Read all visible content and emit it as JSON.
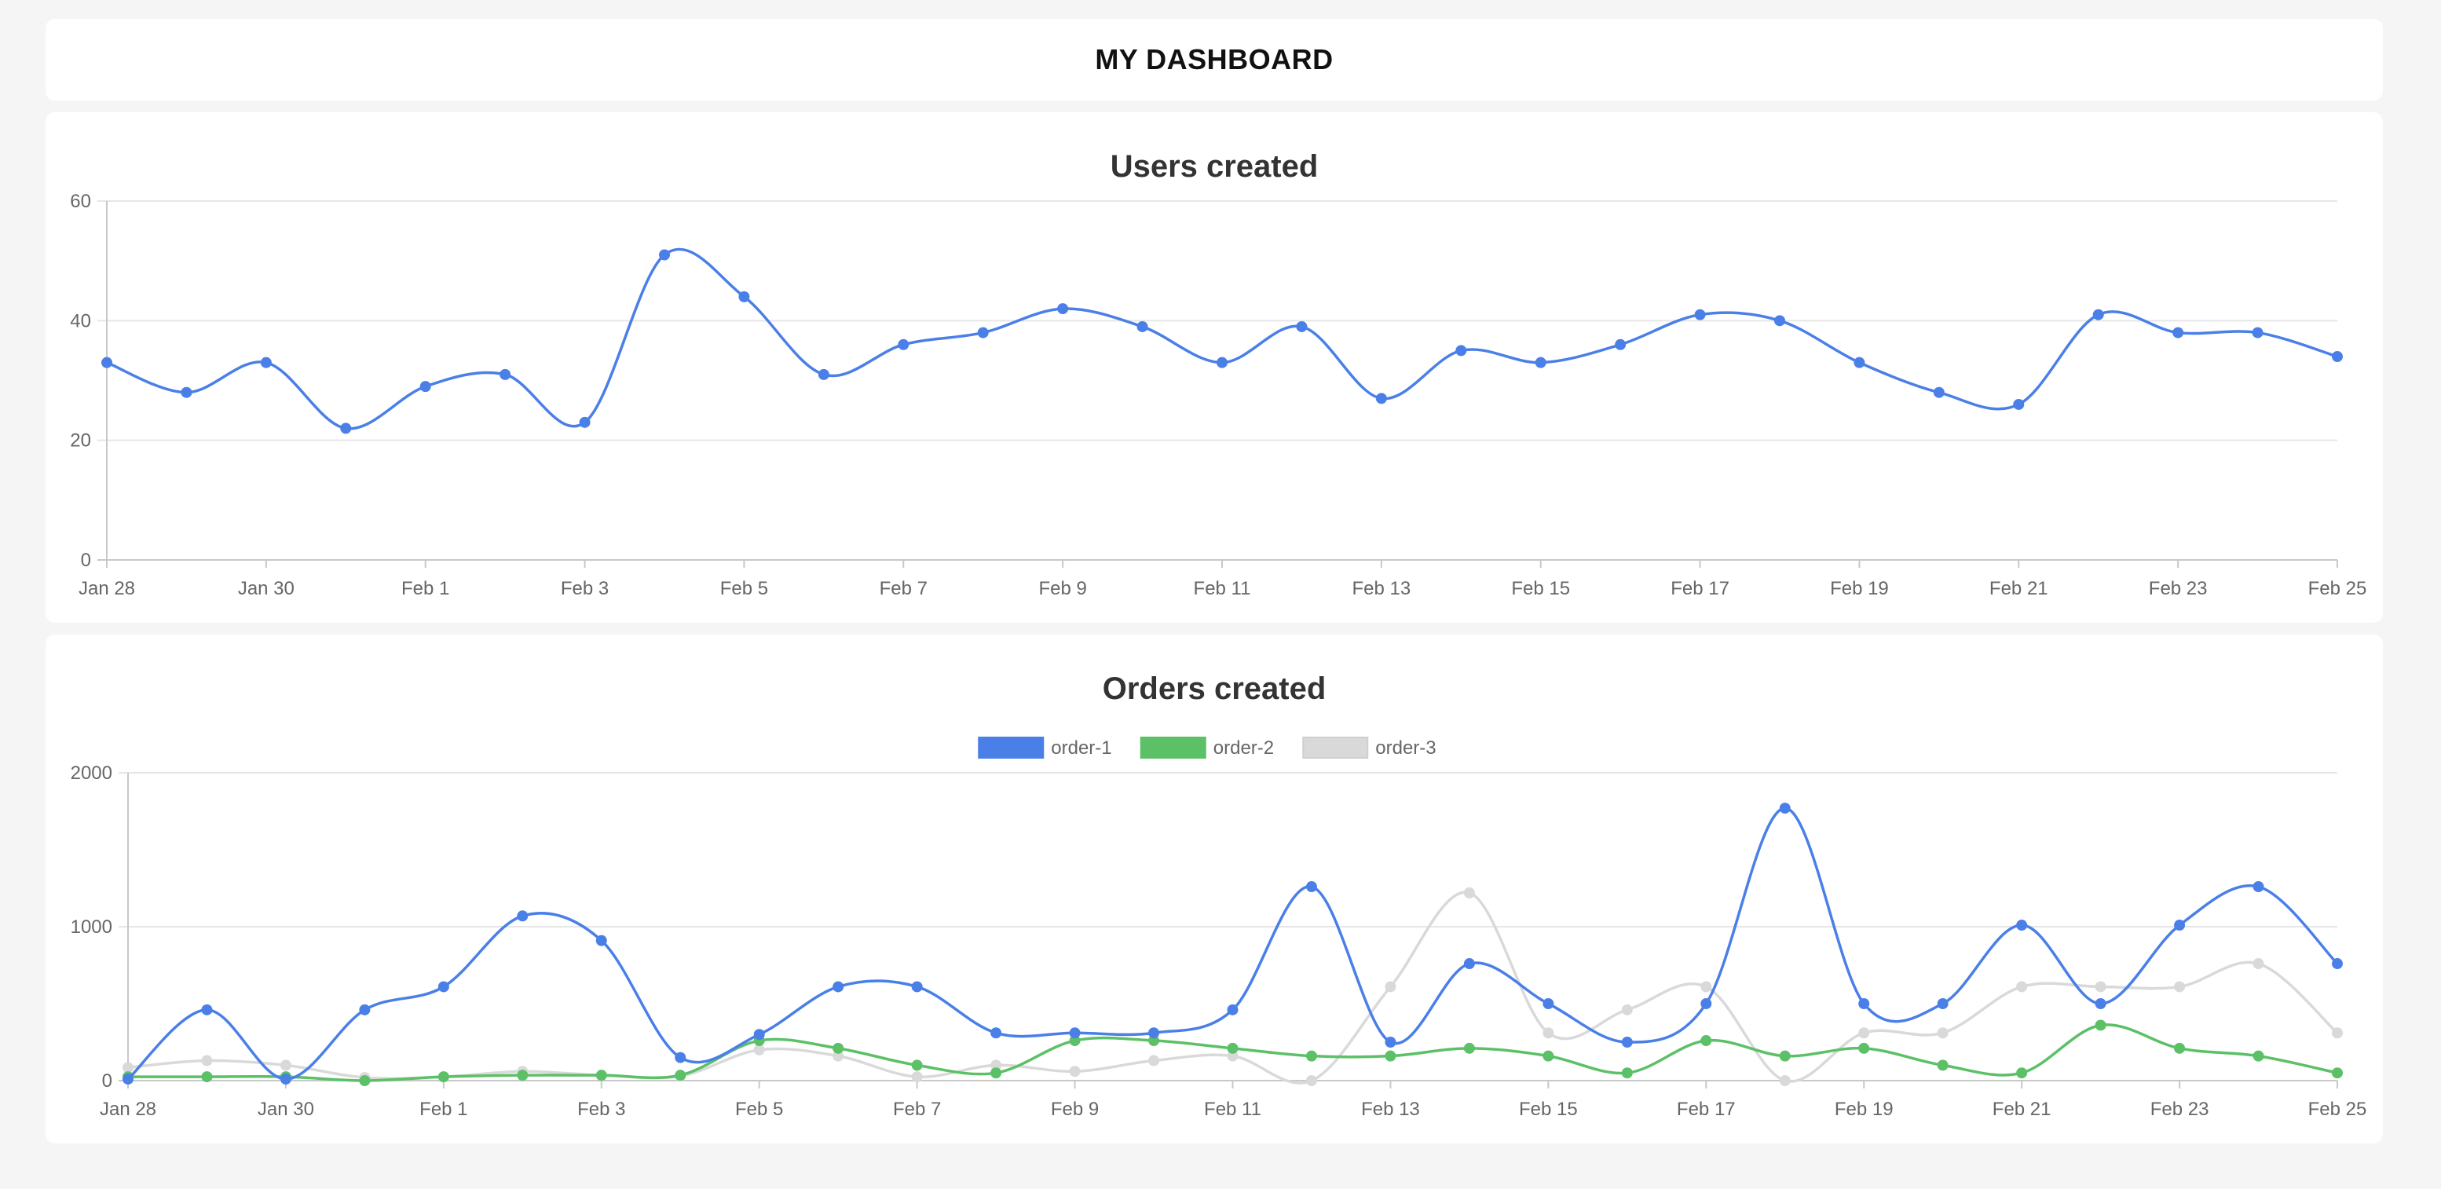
{
  "page": {
    "title": "MY DASHBOARD"
  },
  "chart_data": [
    {
      "type": "line",
      "title": "Users created",
      "x": [
        "Jan 28",
        "Jan 29",
        "Jan 30",
        "Jan 31",
        "Feb 1",
        "Feb 2",
        "Feb 3",
        "Feb 4",
        "Feb 5",
        "Feb 6",
        "Feb 7",
        "Feb 8",
        "Feb 9",
        "Feb 10",
        "Feb 11",
        "Feb 12",
        "Feb 13",
        "Feb 14",
        "Feb 15",
        "Feb 16",
        "Feb 17",
        "Feb 18",
        "Feb 19",
        "Feb 20",
        "Feb 21",
        "Feb 22",
        "Feb 23",
        "Feb 24",
        "Feb 25"
      ],
      "x_tick_labels": [
        "Jan 28",
        "Jan 30",
        "Feb 1",
        "Feb 3",
        "Feb 5",
        "Feb 7",
        "Feb 9",
        "Feb 11",
        "Feb 13",
        "Feb 15",
        "Feb 17",
        "Feb 19",
        "Feb 21",
        "Feb 23",
        "Feb 25"
      ],
      "y_tick_labels": [
        "0",
        "20",
        "40",
        "60"
      ],
      "ylim": [
        0,
        60
      ],
      "grid": true,
      "legend": false,
      "series": [
        {
          "color": "#4a7fe8",
          "values": [
            33,
            28,
            33,
            22,
            29,
            31,
            23,
            51,
            44,
            31,
            36,
            38,
            42,
            39,
            33,
            39,
            27,
            35,
            33,
            36,
            41,
            40,
            33,
            28,
            26,
            41,
            38,
            38,
            34
          ]
        }
      ]
    },
    {
      "type": "line",
      "title": "Orders created",
      "x": [
        "Jan 28",
        "Jan 29",
        "Jan 30",
        "Jan 31",
        "Feb 1",
        "Feb 2",
        "Feb 3",
        "Feb 4",
        "Feb 5",
        "Feb 6",
        "Feb 7",
        "Feb 8",
        "Feb 9",
        "Feb 10",
        "Feb 11",
        "Feb 12",
        "Feb 13",
        "Feb 14",
        "Feb 15",
        "Feb 16",
        "Feb 17",
        "Feb 18",
        "Feb 19",
        "Feb 20",
        "Feb 21",
        "Feb 22",
        "Feb 23",
        "Feb 24",
        "Feb 25"
      ],
      "x_tick_labels": [
        "Jan 28",
        "Jan 30",
        "Feb 1",
        "Feb 3",
        "Feb 5",
        "Feb 7",
        "Feb 9",
        "Feb 11",
        "Feb 13",
        "Feb 15",
        "Feb 17",
        "Feb 19",
        "Feb 21",
        "Feb 23",
        "Feb 25"
      ],
      "y_tick_labels": [
        "0",
        "1000",
        "2000"
      ],
      "ylim": [
        0,
        2000
      ],
      "grid": true,
      "legend": "top",
      "series": [
        {
          "name": "order-1",
          "color": "#4a7fe8",
          "values": [
            10,
            460,
            10,
            460,
            610,
            1070,
            910,
            150,
            300,
            610,
            610,
            310,
            310,
            310,
            460,
            1260,
            250,
            760,
            500,
            250,
            500,
            1770,
            500,
            500,
            1010,
            500,
            1010,
            1260,
            760
          ]
        },
        {
          "name": "order-2",
          "color": "#5cc067",
          "values": [
            25,
            25,
            25,
            0,
            25,
            35,
            35,
            35,
            260,
            210,
            100,
            50,
            260,
            260,
            210,
            160,
            160,
            210,
            160,
            50,
            260,
            160,
            210,
            100,
            50,
            360,
            210,
            160,
            50
          ]
        },
        {
          "name": "order-3",
          "color": "#d9d9d9",
          "values": [
            85,
            130,
            100,
            20,
            25,
            60,
            35,
            30,
            200,
            160,
            25,
            100,
            60,
            130,
            160,
            0,
            610,
            1220,
            310,
            460,
            610,
            0,
            310,
            310,
            610,
            610,
            610,
            760,
            310
          ]
        }
      ]
    }
  ]
}
